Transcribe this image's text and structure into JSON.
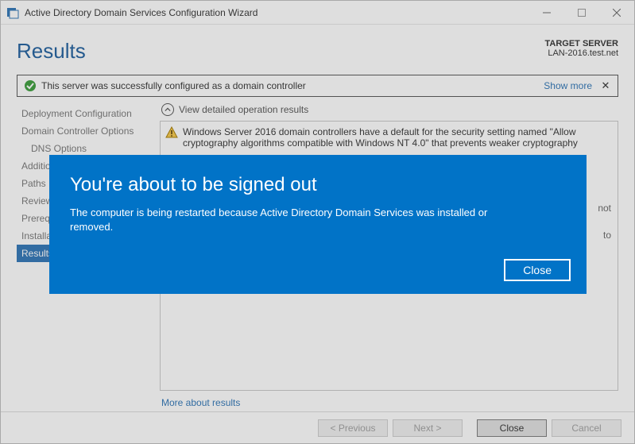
{
  "window": {
    "title": "Active Directory Domain Services Configuration Wizard"
  },
  "header": {
    "heading": "Results",
    "target_label": "TARGET SERVER",
    "target_value": "LAN-2016.test.net"
  },
  "notice": {
    "message": "This server was successfully configured as a domain controller",
    "show_more": "Show more",
    "close": "✕"
  },
  "nav": {
    "items": [
      {
        "label": "Deployment Configuration"
      },
      {
        "label": "Domain Controller Options"
      },
      {
        "label": "DNS Options",
        "sub": true
      },
      {
        "label": "Additional Options"
      },
      {
        "label": "Paths"
      },
      {
        "label": "Review Options"
      },
      {
        "label": "Prerequisites Check"
      },
      {
        "label": "Installation"
      },
      {
        "label": "Results",
        "selected": true
      }
    ]
  },
  "content": {
    "view_label": "View detailed operation results",
    "warning_text": "Windows Server 2016 domain controllers have a default for the security setting named \"Allow cryptography algorithms compatible with Windows NT 4.0\" that prevents weaker cryptography",
    "cutoff_fragments": [
      "not",
      "to"
    ],
    "more_link": "More about results"
  },
  "footer": {
    "previous": "< Previous",
    "next": "Next >",
    "close": "Close",
    "cancel": "Cancel"
  },
  "signout": {
    "title": "You're about to be signed out",
    "body": "The computer is being restarted because Active Directory Domain Services was installed or removed.",
    "close": "Close"
  }
}
